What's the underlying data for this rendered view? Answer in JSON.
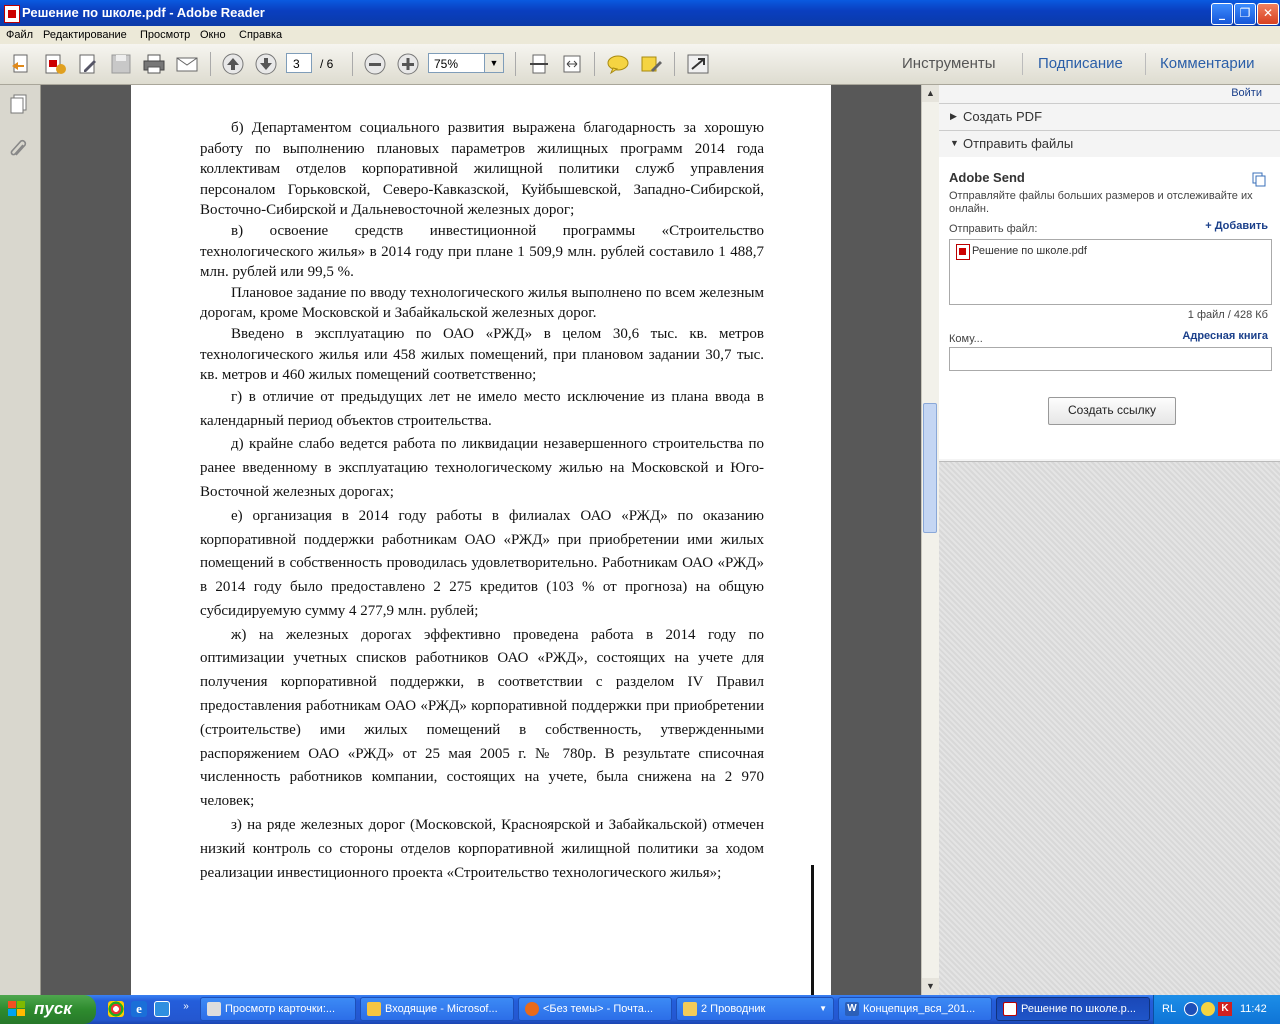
{
  "window": {
    "title": "Решение по школе.pdf - Adobe Reader"
  },
  "menu": [
    "Файл",
    "Редактирование",
    "Просмотр",
    "Окно",
    "Справка"
  ],
  "toolbar": {
    "current_page": "3",
    "page_total": "/ 6",
    "zoom": "75%",
    "tab_tools": "Инструменты",
    "tab_sign": "Подписание",
    "tab_comments": "Комментарии"
  },
  "document": {
    "paragraphs_block1": [
      "б) Департаментом социального развития выражена благодарность за хорошую работу по выполнению плановых параметров жилищных программ 2014 года коллективам отделов корпоративной жилищной политики служб управления персоналом Горьковской, Северо-Кавказской, Куйбышевской, Западно-Сибирской, Восточно-Сибирской и Дальневосточной железных дорог;",
      "в) освоение средств инвестиционной программы «Строительство технологического жилья» в 2014 году при плане 1 509,9 млн. рублей составило 1 488,7 млн. рублей или 99,5 %.",
      "Плановое задание по вводу технологического жилья выполнено по всем железным дорогам, кроме Московской и Забайкальской железных дорог.",
      "Введено в эксплуатацию по ОАО «РЖД» в целом 30,6 тыс. кв. метров технологического жилья или 458 жилых помещений, при плановом задании 30,7 тыс. кв. метров и 460 жилых помещений соответственно;"
    ],
    "paragraphs_block2": [
      "г) в отличие от предыдущих лет не имело место исключение из плана ввода в календарный период объектов строительства.",
      "д) крайне слабо ведется работа по ликвидации незавершенного строительства по ранее введенному в эксплуатацию технологическому жилью на Московской и Юго-Восточной железных дорогах;",
      "е) организация в 2014 году работы в филиалах ОАО «РЖД» по оказанию корпоративной поддержки работникам ОАО «РЖД» при приобретении ими жилых помещений в собственность проводилась удовлетворительно. Работникам ОАО «РЖД» в 2014 году было предоставлено 2 275 кредитов (103 % от прогноза) на общую субсидируемую сумму 4 277,9 млн. рублей;",
      "ж) на железных дорогах эффективно проведена работа в 2014 году по оптимизации учетных списков работников ОАО «РЖД», состоящих на учете для получения корпоративной поддержки, в соответствии с разделом IV Правил предоставления работникам ОАО «РЖД» корпоративной поддержки при приобретении (строительстве) ими жилых помещений в собственность, утвержденными распоряжением ОАО «РЖД» от 25 мая 2005 г. № 780р. В результате списочная численность работников компании, состоящих на учете, была снижена на 2 970 человек;",
      "з) на ряде железных дорог (Московской, Красноярской и Забайкальской) отмечен низкий контроль со стороны отделов корпоративной жилищной политики за ходом реализации инвестиционного проекта «Строительство технологического жилья»;"
    ]
  },
  "right_pane": {
    "sign_in": "Войти",
    "create_pdf": "Создать PDF",
    "send_files": "Отправить файлы",
    "adobe_send_title": "Adobe Send",
    "adobe_send_desc": "Отправляйте файлы больших размеров и отслеживайте их онлайн.",
    "send_file_label": "Отправить файл:",
    "add_link": "+ Добавить",
    "file_name": "Решение по школе.pdf",
    "file_summary": "1 файл / 428 Кб",
    "to_label": "Кому...",
    "address_book": "Адресная книга",
    "create_link_button": "Создать ссылку"
  },
  "taskbar": {
    "start": "пуск",
    "tasks": [
      "Просмотр карточки:...",
      "Входящие - Microsof...",
      "<Без темы> - Почта...",
      "2 Проводник",
      "Концепция_вся_201...",
      "Решение по школе.p..."
    ],
    "lang": "RL",
    "clock": "11:42"
  },
  "colors": {
    "titlebar": "#0a4fd0",
    "document_bg": "#585858",
    "taskbar": "#245edb",
    "start_button": "#2e8b2e"
  }
}
